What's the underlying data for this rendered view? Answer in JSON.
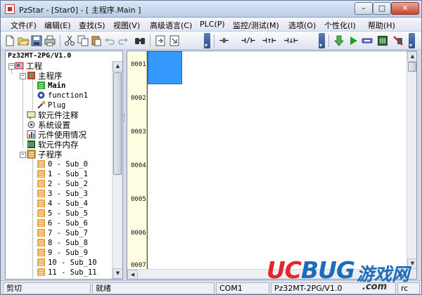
{
  "window": {
    "title": "PzStar - [Star0] - [ 主程序.Main ]",
    "minimize_glyph": "–",
    "maximize_glyph": "□",
    "close_glyph": "✕"
  },
  "menu": [
    "文件(F)",
    "编辑(E)",
    "查找(S)",
    "视图(V)",
    "高级语言(C)",
    "PLC(P)",
    "监控/测试(M)",
    "选项(O)",
    "个性化(I)",
    "帮助(H)"
  ],
  "toolbar": {
    "icons": [
      "new-file-icon",
      "open-folder-icon",
      "save-icon",
      "print-icon",
      "cut-icon",
      "copy-icon",
      "paste-icon",
      "undo-icon",
      "redo-icon",
      "find-icon",
      "import-icon",
      "export-icon"
    ],
    "ladder_symbols": [
      "⊣⊢",
      "⊣/⊢",
      "⊣↑⊢",
      "⊣↓⊢"
    ],
    "right_icons": [
      "download-icon",
      "run-icon",
      "cable-icon",
      "monitor-icon",
      "stop-icon"
    ]
  },
  "project": {
    "header": "Pz32MT-2PG/V1.0",
    "root": "工程",
    "main_program": "主程序",
    "main_items": [
      "Main",
      "function1",
      "Plug"
    ],
    "folders": [
      "软元件注释",
      "系统设置",
      "元件使用情况",
      "软元件内存"
    ],
    "subroutine_root": "子程序",
    "subroutines": [
      "0 - Sub_0",
      "1 - Sub_1",
      "2 - Sub_2",
      "3 - Sub_3",
      "4 - Sub_4",
      "5 - Sub_5",
      "6 - Sub_6",
      "7 - Sub_7",
      "8 - Sub_8",
      "9 - Sub_9",
      "10 - Sub_10",
      "11 - Sub_11"
    ]
  },
  "editor": {
    "steps": [
      "0001",
      "0002",
      "0003",
      "0004",
      "0005",
      "0006",
      "0007"
    ]
  },
  "statusbar": {
    "action": "剪切",
    "state": "就绪",
    "port": "COM1",
    "model": "Pz32MT-2PG/V1.0",
    "extra": "rc"
  },
  "watermark": {
    "brand_a": "UC",
    "brand_b": "BUG",
    "cn": "游戏网",
    "domain": ".com"
  },
  "colors": {
    "cursor": "#3399ff",
    "ruler": "#fffde2",
    "brand_red": "#e3262a",
    "brand_blue": "#1b6dbb"
  }
}
